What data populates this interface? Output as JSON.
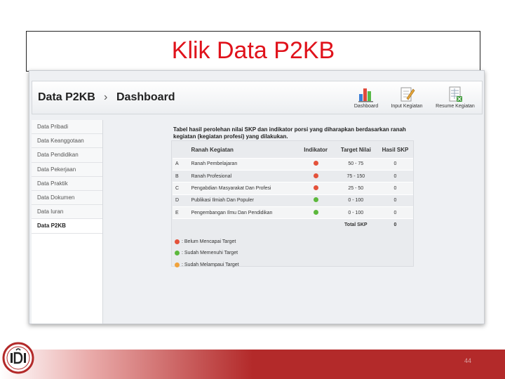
{
  "slide": {
    "title": "Klik Data P2KB",
    "page_number": "44"
  },
  "header": {
    "breadcrumb": [
      "Data P2KB",
      "Dashboard"
    ],
    "breadcrumb_separator": "›",
    "tools": [
      {
        "label": "Dashboard",
        "icon": "bar-chart-icon"
      },
      {
        "label": "Input Kegiatan",
        "icon": "edit-document-icon"
      },
      {
        "label": "Resume Kegiatan",
        "icon": "spreadsheet-icon"
      }
    ]
  },
  "sidebar": {
    "items": [
      {
        "label": "Data Pribadi"
      },
      {
        "label": "Data Keanggotaan"
      },
      {
        "label": "Data Pendidikan"
      },
      {
        "label": "Data Pekerjaan"
      },
      {
        "label": "Data Praktik"
      },
      {
        "label": "Data Dokumen"
      },
      {
        "label": "Data Iuran"
      },
      {
        "label": "Data P2KB",
        "active": true
      }
    ]
  },
  "main": {
    "caption": "Tabel hasil perolehan nilai SKP dan indikator porsi yang diharapkan berdasarkan ranah kegiatan (kegiatan profesi) yang dilakukan.",
    "table": {
      "headers": [
        "",
        "Ranah Kegiatan",
        "Indikator",
        "Target Nilai",
        "Hasil SKP"
      ],
      "rows": [
        {
          "code": "A",
          "name": "Ranah Pembelajaran",
          "indicator": "red",
          "target": "50 - 75",
          "result": "0"
        },
        {
          "code": "B",
          "name": "Ranah Profesional",
          "indicator": "red",
          "target": "75 - 150",
          "result": "0"
        },
        {
          "code": "C",
          "name": "Pengabdian Masyarakat Dan Profesi",
          "indicator": "red",
          "target": "25 - 50",
          "result": "0"
        },
        {
          "code": "D",
          "name": "Publikasi Ilmiah Dan Populer",
          "indicator": "green",
          "target": "0 - 100",
          "result": "0"
        },
        {
          "code": "E",
          "name": "Pengembangan Ilmu Dan Pendidikan",
          "indicator": "green",
          "target": "0 - 100",
          "result": "0"
        }
      ],
      "total_label": "Total SKP",
      "total_value": "0"
    },
    "legend": [
      {
        "color": "red",
        "label": ": Belum Mencapai Target"
      },
      {
        "color": "green",
        "label": ": Sudah Memenuhi Target"
      },
      {
        "color": "orange",
        "label": ": Sudah Melampaui Target"
      }
    ]
  },
  "colors": {
    "red": "#e4523b",
    "green": "#5cb83c",
    "orange": "#f0a23c",
    "title": "#e0121b",
    "footer": "#b32a2a"
  }
}
